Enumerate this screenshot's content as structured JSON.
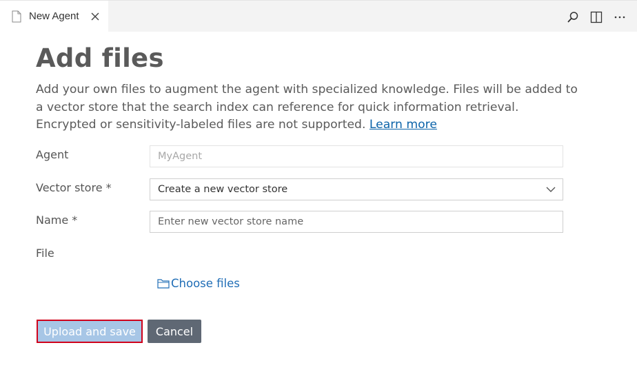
{
  "tab": {
    "title": "New Agent",
    "icons": {
      "file": "file-icon",
      "close": "close-icon"
    }
  },
  "toolbar": {
    "icons": [
      "search-icon",
      "split-editor-icon",
      "more-actions-icon"
    ]
  },
  "page": {
    "title": "Add files",
    "description": "Add your own files to augment the agent with specialized knowledge. Files will be added to a vector store that the search index can reference for quick information retrieval. Encrypted or sensitivity-labeled files are not supported.",
    "learn_more": "Learn more"
  },
  "form": {
    "agent_label": "Agent",
    "agent_value": "MyAgent",
    "vector_store_label": "Vector store *",
    "vector_store_value": "Create a new vector store",
    "name_label": "Name *",
    "name_placeholder": "Enter new vector store name",
    "file_label": "File",
    "choose_files": "Choose files"
  },
  "buttons": {
    "upload_save": "Upload and save",
    "cancel": "Cancel"
  },
  "colors": {
    "link": "#0b63a9",
    "upload_button": "#a7c6e6",
    "upload_highlight_border": "#d0021b",
    "cancel_button": "#5f6874"
  }
}
